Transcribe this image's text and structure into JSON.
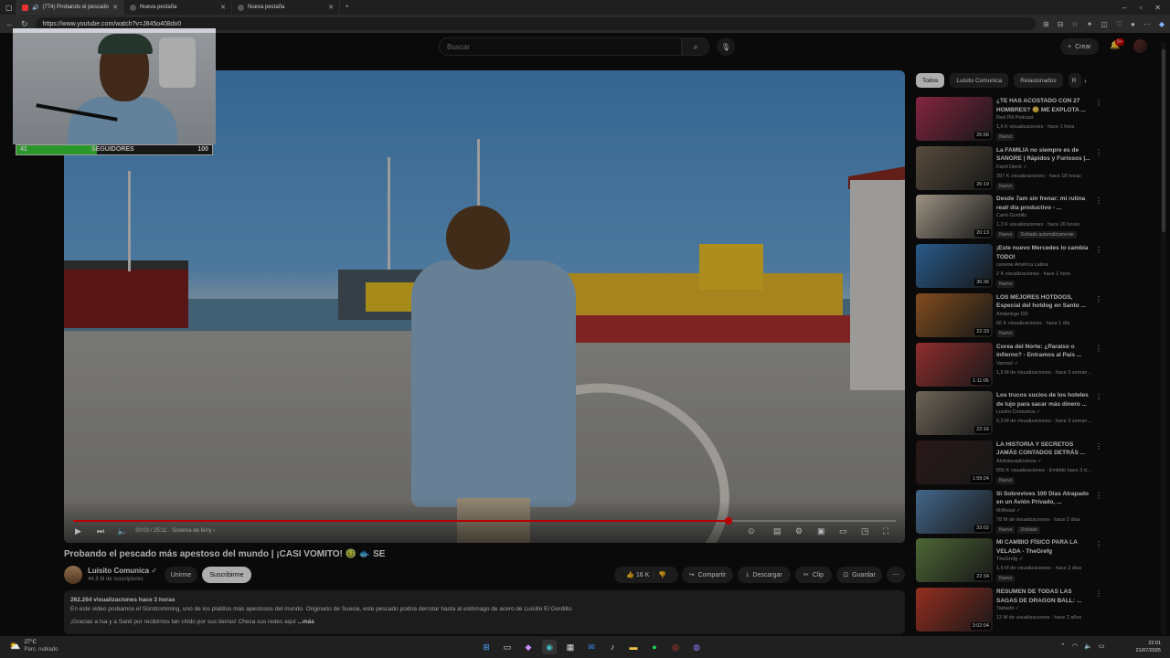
{
  "browser": {
    "tabs": [
      {
        "label": "(774) Probando el pescado",
        "active": true
      },
      {
        "label": "Nueva pestaña",
        "active": false
      },
      {
        "label": "Nueva pestaña",
        "active": false
      }
    ],
    "url": "https://www.youtube.com/watch?v=J845o408dv0"
  },
  "header": {
    "search_placeholder": "Buscar",
    "create_label": "Crear",
    "notif_badge": "9+"
  },
  "overlay": {
    "followers_label": "SEGUIDORES",
    "followers_current": "41",
    "followers_goal": "100",
    "followers_fraction": 0.41
  },
  "player": {
    "time": "20:03 / 25:11",
    "chapter": "Sistema de ferry",
    "progress_fraction": 0.797
  },
  "video": {
    "title": "Probando el pescado más apestoso del mundo | ¡CASI VOMITO! 🤢 🐟 SE",
    "channel": "Luisito Comunica",
    "subscribers": "44,9 M de suscriptores",
    "join_label": "Unirme",
    "subscribe_label": "Suscribirme",
    "likes": "16 K",
    "share_label": "Compartir",
    "download_label": "Descargar",
    "clip_label": "Clip",
    "save_label": "Guardar",
    "desc_stats": "262.264 visualizaciones  hace 3 horas",
    "desc_line1": "En este video probamos el Sürstromming, uno de los platillos más apestosos del mundo. Originario de Suecia, este pescado podría derrotar hasta al estómago de acero de Luisillo El Gordillo.",
    "desc_line2": "¡Gracias a Isa y a Santi por recibirnos tan chido por sus tierras! Checa sus redes aquí",
    "desc_more": "...más"
  },
  "sidebar": {
    "chips": [
      "Todos",
      "Luisito Comunica",
      "Relacionados",
      "R"
    ],
    "items": [
      {
        "title": "¿TE HAS ACOSTADO CON 27 HOMBRES? 😳 ME EXPLOTA ...",
        "channel": "Red Pill Podcast",
        "meta": "1,6 K visualizaciones · hace 1 hora",
        "badges": [
          "Nuevo"
        ],
        "duration": "26:56",
        "thumb": "#b8335a"
      },
      {
        "title": "La FAMILIA no siempre es de SANGRE | Rápidos y Furiosos |...",
        "channel": "Farid Dieck ✓",
        "meta": "397 K visualizaciones · hace 18 horas",
        "badges": [
          "Nuevo"
        ],
        "duration": "26:19",
        "thumb": "#7a6a55"
      },
      {
        "title": "Desde 7am sin frenar: mi rutina real/ día productivo - ...",
        "channel": "Cami Gordillo",
        "meta": "1,3 K visualizaciones · hace 20 horas",
        "badges": [
          "Nuevo",
          "Doblado automáticamente"
        ],
        "duration": "20:13",
        "thumb": "#d8cbb5"
      },
      {
        "title": "¡Este nuevo Mercedes lo cambia TODO!",
        "channel": "carwow América Latina",
        "meta": "2 K visualizaciones · hace 1 hora",
        "badges": [
          "Nuevo"
        ],
        "duration": "36:36",
        "thumb": "#3b7fc4"
      },
      {
        "title": "LOS MEJORES HOTDOGS, Especial del hotdog en Santo ...",
        "channel": "Andariego DD",
        "meta": "66 K visualizaciones · hace 1 día",
        "badges": [
          "Nuevo"
        ],
        "duration": "22:33",
        "thumb": "#b56a2c"
      },
      {
        "title": "Corea del Norte: ¿Paraíso o infierno? - Entramos al País ...",
        "channel": "Vamos! ✓",
        "meta": "1,5 M de visualizaciones · hace 3 seman...",
        "badges": [],
        "duration": "1:11:05",
        "thumb": "#c94040"
      },
      {
        "title": "Los trucos sucios de los hoteles de lujo para sacar más dinero ...",
        "channel": "Luisito Comunica ✓",
        "meta": "6,3 M de visualizaciones · hace 3 seman...",
        "badges": [],
        "duration": "22:16",
        "thumb": "#9a8d7a"
      },
      {
        "title": "LA HISTORIA Y SECRETOS JAMÁS CONTADOS DETRÁS ...",
        "channel": "Alofokeradioshow ✓",
        "meta": "655 K visualizaciones · Emitido hace 3 d...",
        "badges": [
          "Nuevo"
        ],
        "duration": "1:59:24",
        "thumb": "#3a2222"
      },
      {
        "title": "Si Sobrevives 100 Días Atrapado en un Avión Privado, ...",
        "channel": "MrBeast ✓",
        "meta": "78 M de visualizaciones · hace 2 días",
        "badges": [
          "Nuevo",
          "Doblado"
        ],
        "duration": "33:02",
        "thumb": "#5d8fc0"
      },
      {
        "title": "MI CAMBIO FÍSICO PARA LA VELADA - TheGrefg",
        "channel": "TheGrefg ✓",
        "meta": "1,5 M de visualizaciones · hace 3 días",
        "badges": [
          "Nuevo"
        ],
        "duration": "22:34",
        "thumb": "#6c8f4a"
      },
      {
        "title": "RESUMEN DE TODAS LAS SAGAS DE DRAGON BALL: ...",
        "channel": "Tadashi ✓",
        "meta": "12 M de visualizaciones · hace 2 años",
        "badges": [],
        "duration": "3:02:04",
        "thumb": "#d0402c"
      }
    ]
  },
  "taskbar": {
    "temp": "27°C",
    "weather": "Parc. nublado",
    "time": "22:01",
    "date": "21/07/2025"
  }
}
